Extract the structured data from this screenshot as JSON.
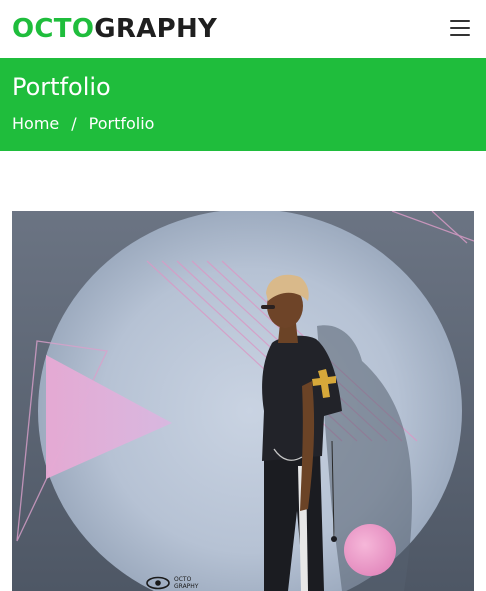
{
  "navbar": {
    "brand_accent": "OCTO",
    "brand_rest": "GRAPHY",
    "menu_icon": "hamburger-menu-icon"
  },
  "header": {
    "title": "Portfolio",
    "breadcrumb": {
      "home": "Home",
      "separator": "/",
      "current": "Portfolio"
    }
  },
  "portfolio": {
    "watermark_line1": "OCTO",
    "watermark_line2": "GRAPHY",
    "watermark_icon": "eye-logo-icon"
  },
  "colors": {
    "accent_green": "#1fbd3c",
    "brand_dark": "#1f1f1f",
    "header_text": "#ffffff"
  }
}
